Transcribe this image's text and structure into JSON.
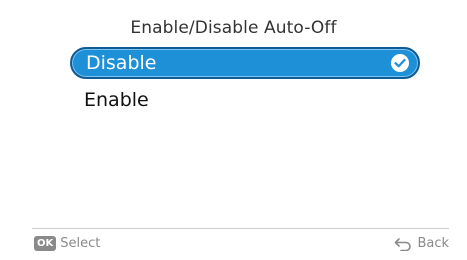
{
  "header": {
    "title": "Enable/Disable Auto-Off"
  },
  "menu": {
    "items": [
      {
        "label": "Disable",
        "selected": true,
        "icon": "check-circle-icon"
      },
      {
        "label": "Enable",
        "selected": false
      }
    ]
  },
  "footer": {
    "ok_badge": "OK",
    "select_label": "Select",
    "back_label": "Back",
    "back_icon": "back-arrow-icon"
  },
  "colors": {
    "selection_fill": "#1e90d8",
    "selection_border": "#0f5c93",
    "hint_text": "#8a8a8a"
  }
}
